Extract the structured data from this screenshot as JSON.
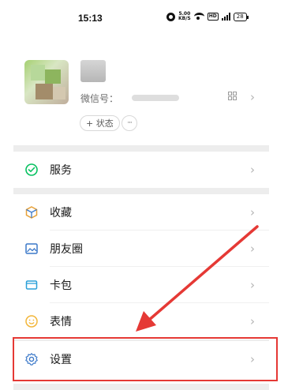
{
  "status_bar": {
    "time": "15:13",
    "network_speed_value": "5.00",
    "network_speed_unit": "KB/S",
    "hd_label": "HD",
    "battery": "28"
  },
  "profile": {
    "wechat_id_label": "微信号：",
    "status_button_label": "+ 状态",
    "more_button_label": "···",
    "chevron": "›"
  },
  "menu": [
    {
      "id": "services",
      "label": "服务",
      "icon": "services-icon",
      "color": "#07c160"
    },
    {
      "id": "favorites",
      "label": "收藏",
      "icon": "favorites-cube-icon",
      "color": "#e8a23a"
    },
    {
      "id": "moments",
      "label": "朋友圈",
      "icon": "moments-image-icon",
      "color": "#3c79c9"
    },
    {
      "id": "cards",
      "label": "卡包",
      "icon": "card-wallet-icon",
      "color": "#2ba0d8"
    },
    {
      "id": "stickers",
      "label": "表情",
      "icon": "sticker-smile-icon",
      "color": "#f2b63a"
    },
    {
      "id": "settings",
      "label": "设置",
      "icon": "settings-gear-icon",
      "color": "#3c79c9"
    }
  ],
  "chevron": "›",
  "annotation": {
    "highlight_color": "#e53935",
    "arrow_color": "#e53935"
  }
}
